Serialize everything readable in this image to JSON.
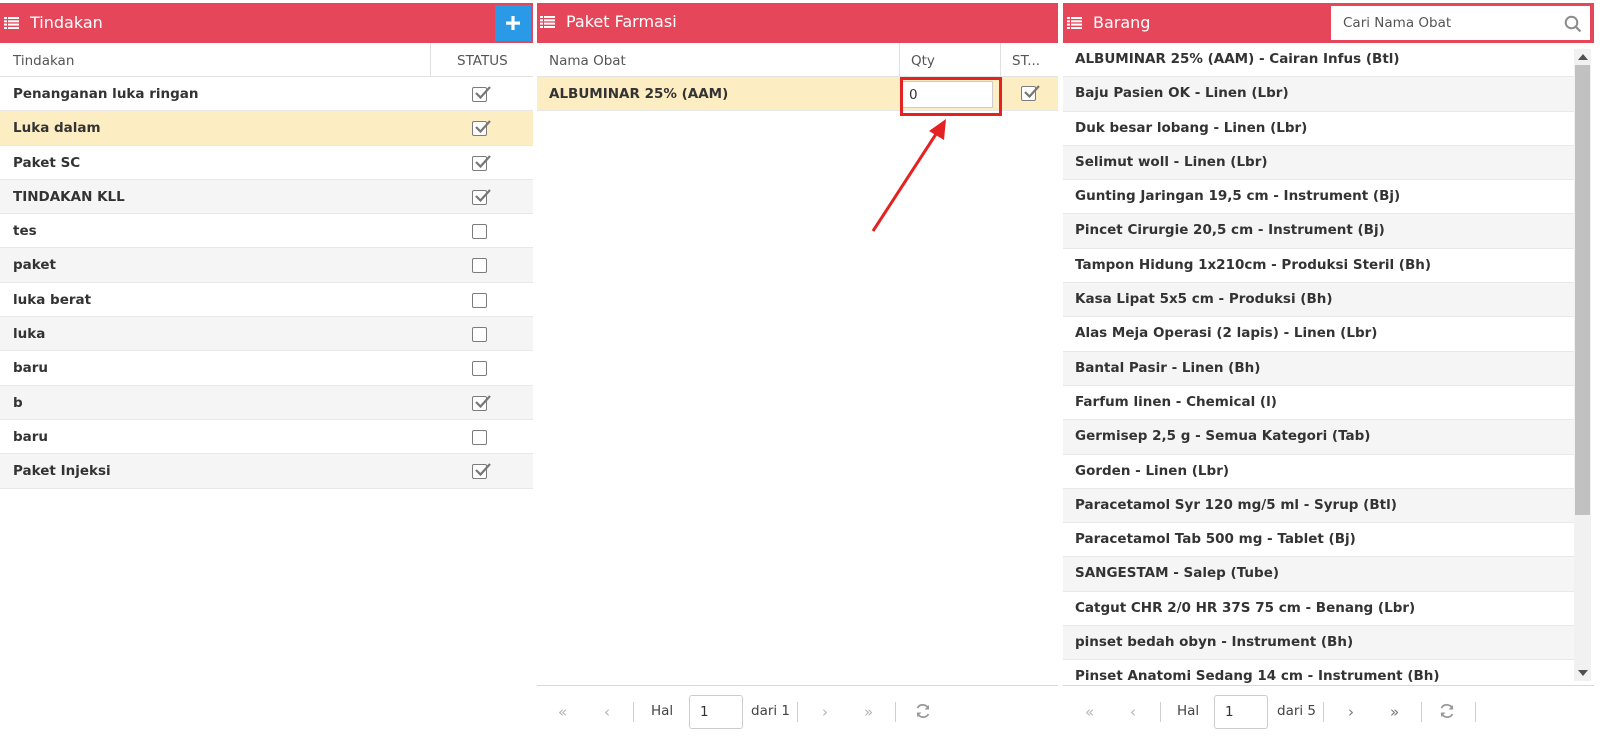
{
  "colors": {
    "header": "#e64659",
    "add_button": "#2b9ae6",
    "selected_row": "#fdedc3",
    "annotation": "#e52222"
  },
  "tindakan": {
    "title": "Tindakan",
    "add_icon": "plus-icon",
    "col_name": "Tindakan",
    "col_status": "STATUS",
    "rows": [
      {
        "name": "Penanganan luka ringan",
        "checked": true
      },
      {
        "name": "Luka dalam",
        "checked": true
      },
      {
        "name": "Paket SC",
        "checked": true
      },
      {
        "name": "TINDAKAN KLL",
        "checked": true
      },
      {
        "name": "tes",
        "checked": false
      },
      {
        "name": "paket",
        "checked": false
      },
      {
        "name": "luka berat",
        "checked": false
      },
      {
        "name": "luka",
        "checked": false
      },
      {
        "name": "baru",
        "checked": false
      },
      {
        "name": "b",
        "checked": true
      },
      {
        "name": "baru",
        "checked": false
      },
      {
        "name": "Paket Injeksi",
        "checked": true
      }
    ],
    "selected_index": 1
  },
  "paket": {
    "title": "Paket Farmasi",
    "col_name": "Nama Obat",
    "col_qty": "Qty",
    "col_status": "ST...",
    "rows": [
      {
        "name": "ALBUMINAR 25% (AAM)",
        "qty": "0",
        "checked": true
      }
    ],
    "pager": {
      "hal": "Hal",
      "page": "1",
      "dari": "dari 1"
    }
  },
  "barang": {
    "title": "Barang",
    "search_placeholder": "Cari Nama Obat",
    "items": [
      "ALBUMINAR 25% (AAM) - Cairan Infus (Btl)",
      "Baju Pasien OK - Linen (Lbr)",
      "Duk besar lobang - Linen (Lbr)",
      "Selimut woll - Linen (Lbr)",
      "Gunting Jaringan 19,5 cm - Instrument (Bj)",
      "Pincet Cirurgie 20,5 cm - Instrument (Bj)",
      "Tampon Hidung 1x210cm - Produksi Steril (Bh)",
      "Kasa Lipat 5x5 cm - Produksi (Bh)",
      "Alas Meja Operasi (2 lapis) - Linen (Lbr)",
      "Bantal Pasir - Linen (Bh)",
      "Farfum linen - Chemical (l)",
      "Germisep 2,5 g - Semua Kategori (Tab)",
      "Gorden - Linen (Lbr)",
      "Paracetamol Syr 120 mg/5 ml - Syrup (Btl)",
      "Paracetamol Tab 500 mg - Tablet (Bj)",
      "SANGESTAM - Salep (Tube)",
      "Catgut CHR 2/0 HR 37S 75 cm - Benang (Lbr)",
      "pinset bedah obyn - Instrument (Bh)",
      "Pinset Anatomi Sedang 14 cm - Instrument (Bh)"
    ],
    "pager": {
      "hal": "Hal",
      "page": "1",
      "dari": "dari 5"
    }
  }
}
